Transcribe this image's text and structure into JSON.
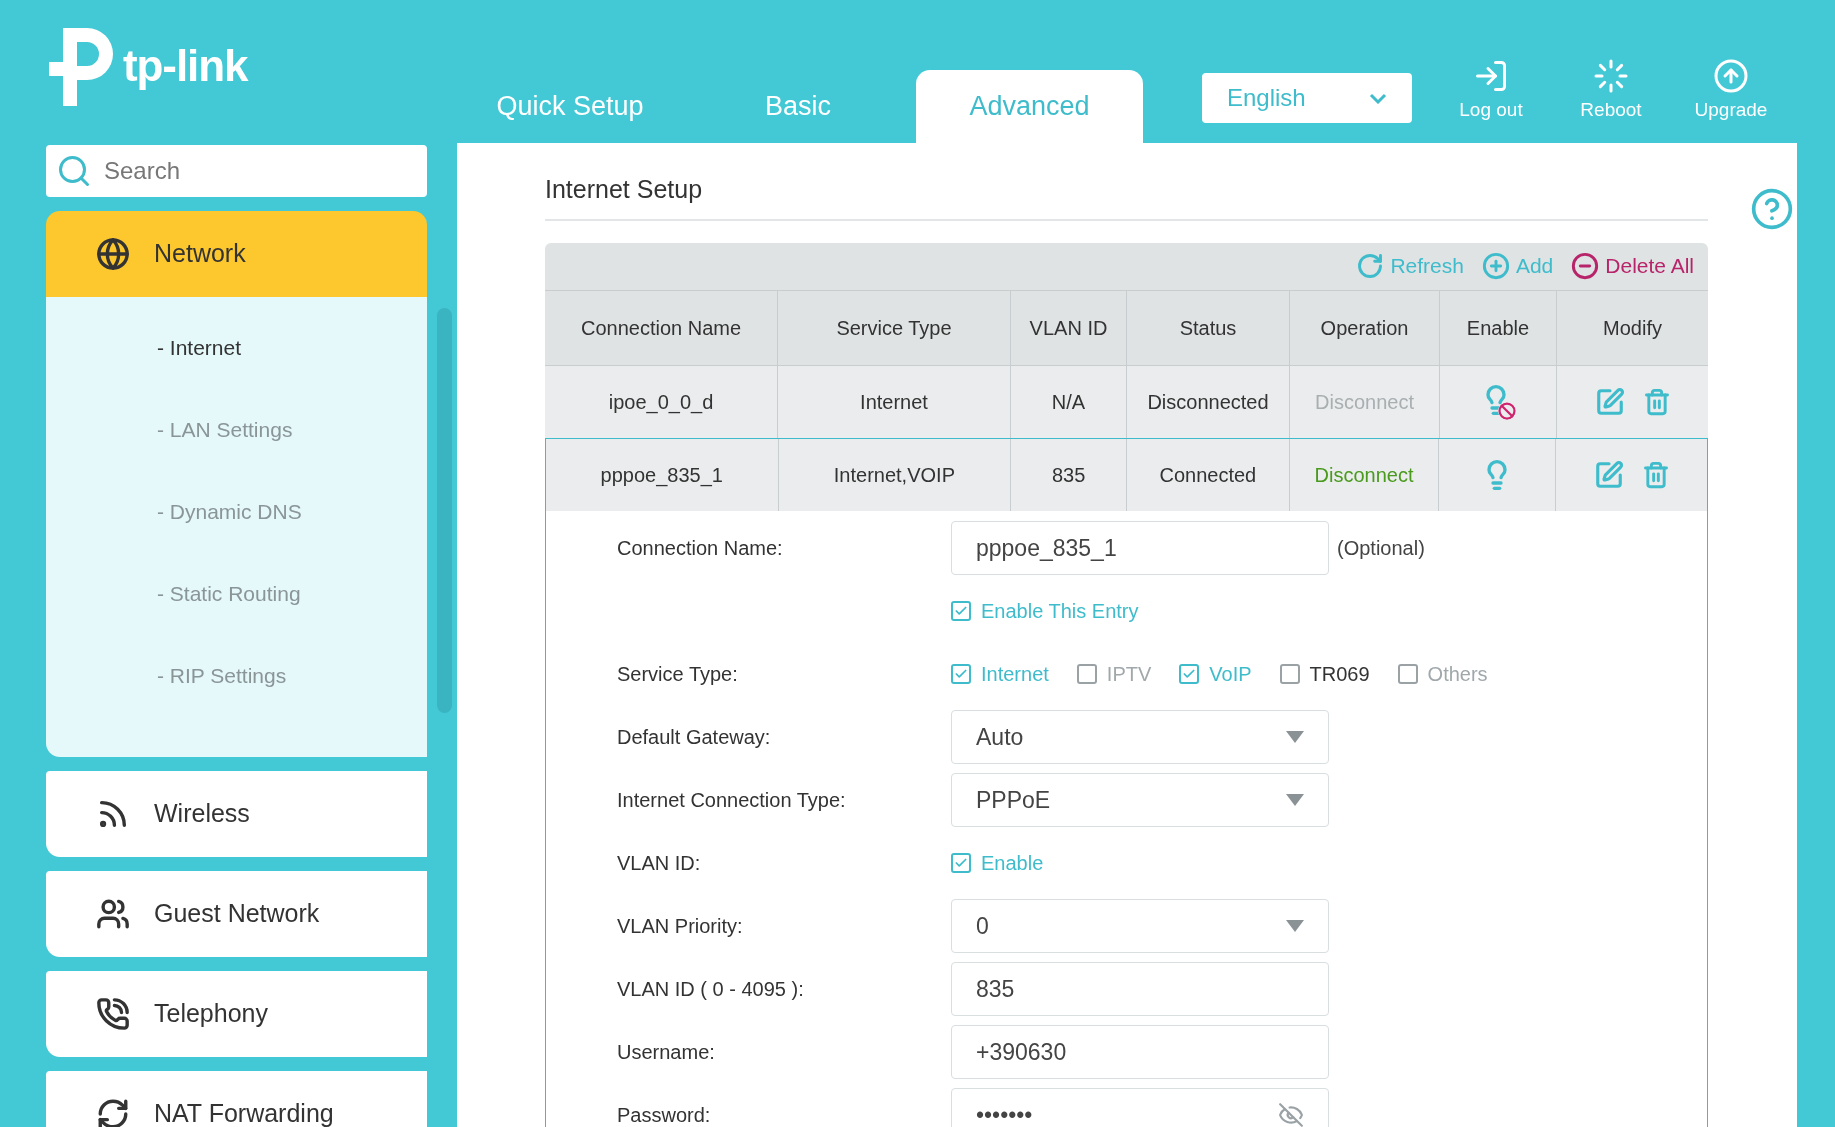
{
  "header": {
    "logo": "tp-link",
    "tabs": [
      {
        "label": "Quick Setup",
        "selected": false
      },
      {
        "label": "Basic",
        "selected": false
      },
      {
        "label": "Advanced",
        "selected": true
      }
    ],
    "language": {
      "value": "English"
    },
    "actions": [
      {
        "label": "Log out",
        "kind": "logout"
      },
      {
        "label": "Reboot",
        "kind": "reboot"
      },
      {
        "label": "Upgrade",
        "kind": "upgrade"
      }
    ]
  },
  "sidebar": {
    "search": {
      "placeholder": "Search"
    },
    "menu": [
      {
        "label": "Network",
        "kind": "network",
        "expanded": true,
        "children": [
          {
            "label": "- Internet",
            "selected": true
          },
          {
            "label": "- LAN Settings",
            "selected": false
          },
          {
            "label": "- Dynamic DNS",
            "selected": false
          },
          {
            "label": "- Static Routing",
            "selected": false
          },
          {
            "label": "- RIP Settings",
            "selected": false
          }
        ]
      },
      {
        "label": "Wireless",
        "kind": "wireless",
        "expanded": false
      },
      {
        "label": "Guest Network",
        "kind": "guest",
        "expanded": false
      },
      {
        "label": "Telephony",
        "kind": "telephony",
        "expanded": false
      },
      {
        "label": "NAT Forwarding",
        "kind": "nat",
        "expanded": false
      }
    ]
  },
  "main": {
    "title": "Internet Setup",
    "toolbar": [
      {
        "label": "Refresh",
        "kind": "refresh"
      },
      {
        "label": "Add",
        "kind": "add"
      },
      {
        "label": "Delete All",
        "kind": "delete"
      }
    ],
    "table": {
      "columns": [
        "Connection Name",
        "Service Type",
        "VLAN ID",
        "Status",
        "Operation",
        "Enable",
        "Modify"
      ],
      "rows": [
        {
          "name": "ipoe_0_0_d",
          "service": "Internet",
          "vlan": "N/A",
          "status": "Disconnected",
          "operation": "Disconnect",
          "connected": false,
          "enabled": false,
          "selected": false
        },
        {
          "name": "pppoe_835_1",
          "service": "Internet,VOIP",
          "vlan": "835",
          "status": "Connected",
          "operation": "Disconnect",
          "connected": true,
          "enabled": true,
          "selected": true
        }
      ]
    },
    "form": [
      {
        "kind": "text",
        "label": "Connection Name:",
        "value": "pppoe_835_1",
        "suffix": "(Optional)"
      },
      {
        "kind": "checkbox",
        "options": [
          {
            "label": "Enable This Entry",
            "checked": true,
            "disabled": false
          }
        ]
      },
      {
        "kind": "checkbox",
        "label": "Service Type:",
        "options": [
          {
            "label": "Internet",
            "checked": true,
            "disabled": false
          },
          {
            "label": "IPTV",
            "checked": false,
            "disabled": true
          },
          {
            "label": "VoIP",
            "checked": true,
            "disabled": false
          },
          {
            "label": "TR069",
            "checked": false,
            "disabled": false
          },
          {
            "label": "Others",
            "checked": false,
            "disabled": true
          }
        ]
      },
      {
        "kind": "select",
        "label": "Default Gateway:",
        "value": "Auto"
      },
      {
        "kind": "select",
        "label": "Internet Connection Type:",
        "value": "PPPoE"
      },
      {
        "kind": "checkbox",
        "label": "VLAN ID:",
        "options": [
          {
            "label": "Enable",
            "checked": true,
            "disabled": false
          }
        ]
      },
      {
        "kind": "select",
        "label": "VLAN Priority:",
        "value": "0"
      },
      {
        "kind": "text",
        "label": "VLAN ID ( 0 - 4095 ):",
        "value": "835"
      },
      {
        "kind": "text",
        "label": "Username:",
        "value": "+390630"
      },
      {
        "kind": "password",
        "label": "Password:",
        "value": "•••••••"
      }
    ]
  }
}
